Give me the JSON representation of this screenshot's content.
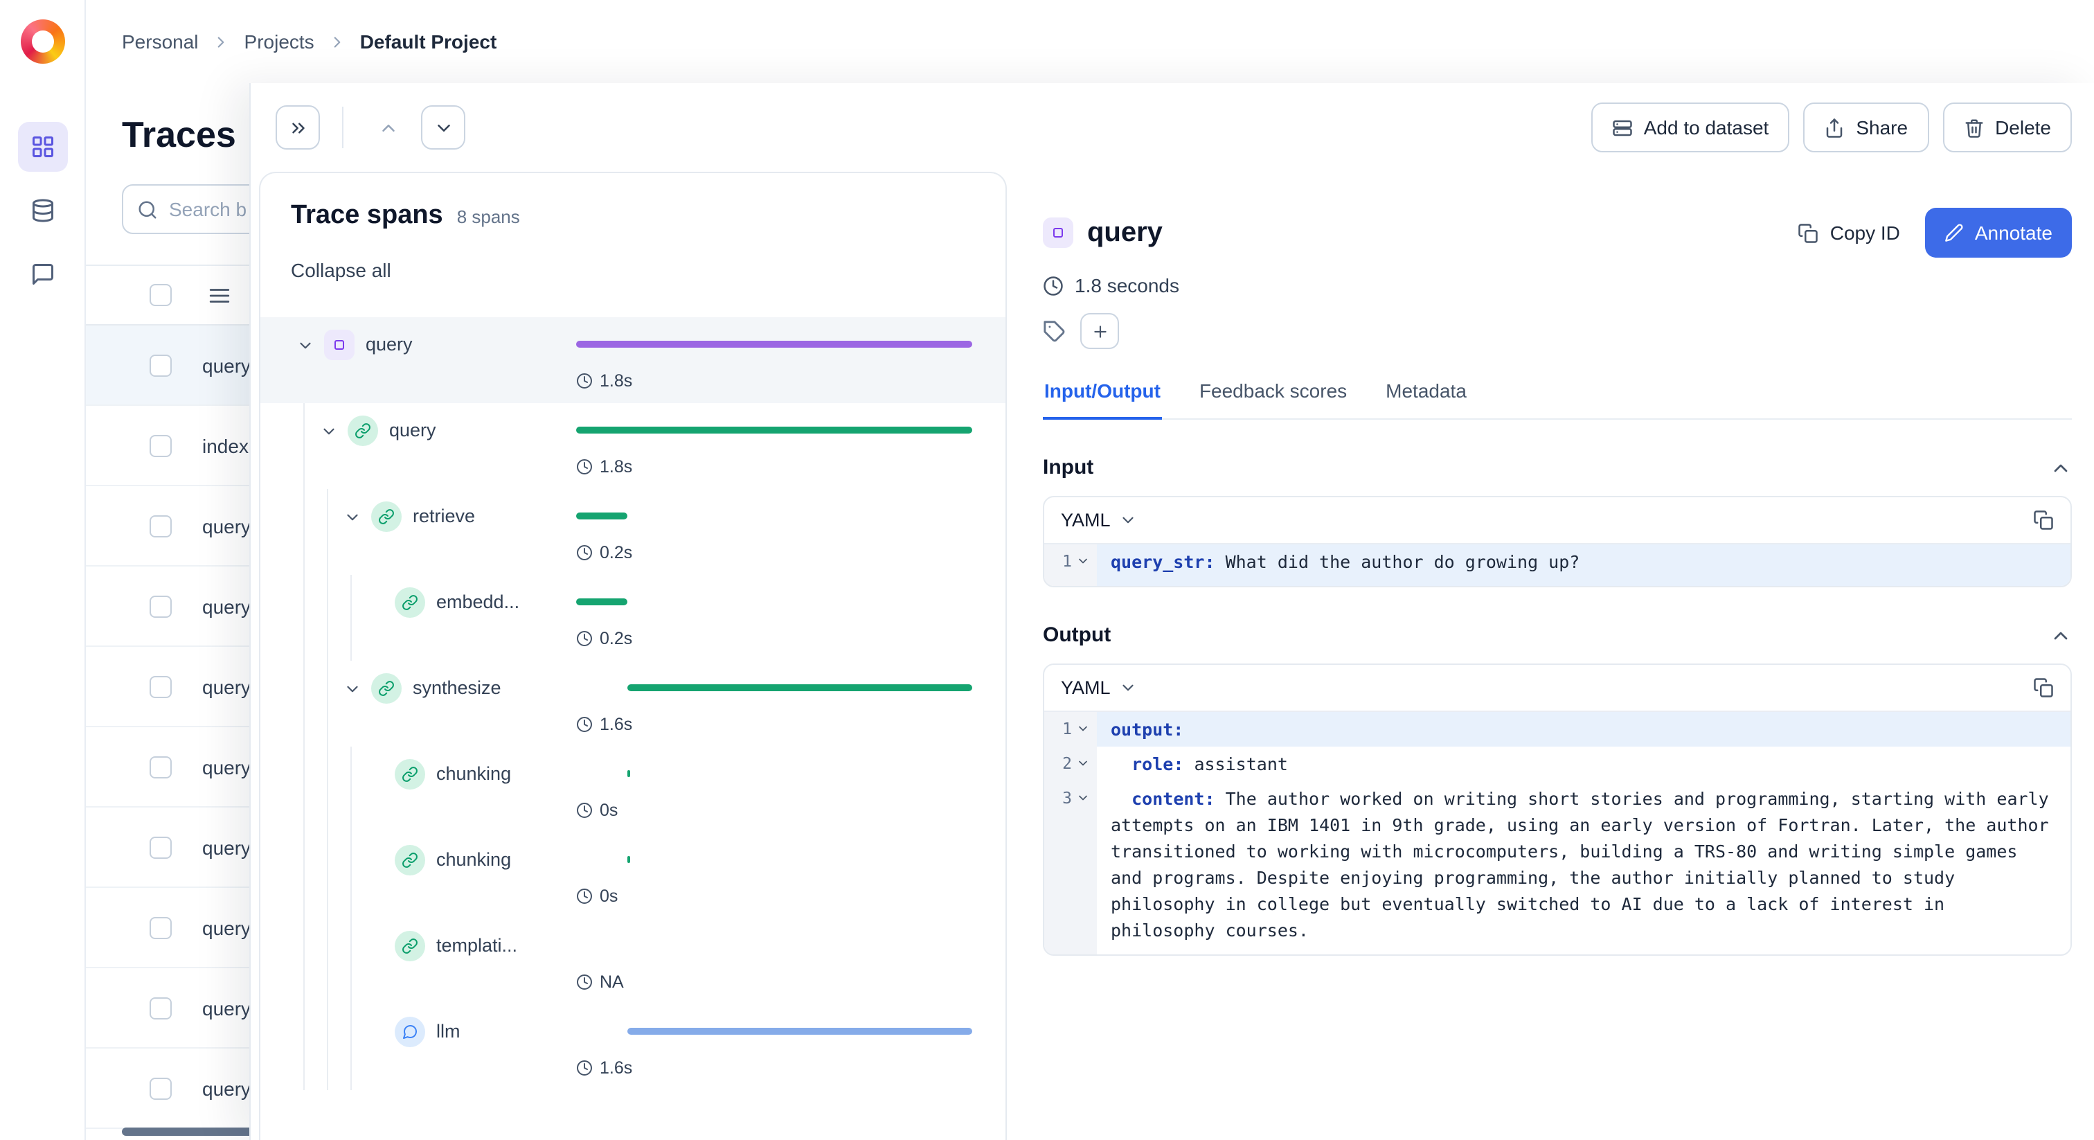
{
  "colors": {
    "accent_purple": "#7c3aed",
    "bar_purple": "#9b66e3",
    "bar_green": "#15a470",
    "bar_blue": "#85abe9",
    "primary_blue": "#3d6be8",
    "tab_active_blue": "#2563eb",
    "yaml_key_blue": "#1e40af"
  },
  "icons": {
    "logo": "comet-logo",
    "sidebar": [
      "grid-icon",
      "database-icon",
      "chat-icon"
    ],
    "toolbar": [
      "double-chevron-right-icon",
      "chevron-up-icon",
      "chevron-down-icon",
      "dataset-icon",
      "share-icon",
      "trash-icon"
    ],
    "details": [
      "copy-icon",
      "pen-icon",
      "clock-icon",
      "tag-icon",
      "plus-icon",
      "search-icon",
      "menu-icon"
    ]
  },
  "breadcrumb": {
    "items": [
      "Personal",
      "Projects",
      "Default Project"
    ]
  },
  "traces_list": {
    "title": "Traces",
    "search_placeholder": "Search b",
    "rows": [
      {
        "label": "query",
        "selected": true
      },
      {
        "label": "index",
        "selected": false
      },
      {
        "label": "query",
        "selected": false
      },
      {
        "label": "query",
        "selected": false
      },
      {
        "label": "query",
        "selected": false
      },
      {
        "label": "query",
        "selected": false
      },
      {
        "label": "query",
        "selected": false
      },
      {
        "label": "query",
        "selected": false
      },
      {
        "label": "query",
        "selected": false
      },
      {
        "label": "query",
        "selected": false
      }
    ]
  },
  "toolbar": {
    "add_to_dataset": "Add to dataset",
    "share": "Share",
    "delete": "Delete"
  },
  "spans_panel": {
    "title": "Trace spans",
    "count_label": "8 spans",
    "collapse_all": "Collapse all",
    "spans": [
      {
        "name": "query",
        "duration": "1.8s",
        "level": 0,
        "type": "trace",
        "expandable": true,
        "selected": true,
        "bar": {
          "start": 0,
          "width": 100,
          "color": "purple"
        }
      },
      {
        "name": "query",
        "duration": "1.8s",
        "level": 1,
        "type": "general",
        "expandable": true,
        "selected": false,
        "bar": {
          "start": 0,
          "width": 100,
          "color": "green"
        }
      },
      {
        "name": "retrieve",
        "duration": "0.2s",
        "level": 2,
        "type": "general",
        "expandable": true,
        "selected": false,
        "bar": {
          "start": 0,
          "width": 13,
          "color": "green"
        }
      },
      {
        "name": "embedd...",
        "duration": "0.2s",
        "level": 3,
        "type": "general",
        "expandable": false,
        "selected": false,
        "bar": {
          "start": 0,
          "width": 13,
          "color": "green"
        }
      },
      {
        "name": "synthesize",
        "duration": "1.6s",
        "level": 2,
        "type": "general",
        "expandable": true,
        "selected": false,
        "bar": {
          "start": 13,
          "width": 87,
          "color": "green"
        }
      },
      {
        "name": "chunking",
        "duration": "0s",
        "level": 3,
        "type": "general",
        "expandable": false,
        "selected": false,
        "bar": {
          "start": 13,
          "width": 0.8,
          "color": "green"
        }
      },
      {
        "name": "chunking",
        "duration": "0s",
        "level": 3,
        "type": "general",
        "expandable": false,
        "selected": false,
        "bar": {
          "start": 13,
          "width": 0.8,
          "color": "green"
        }
      },
      {
        "name": "templati...",
        "duration": "NA",
        "level": 3,
        "type": "general",
        "expandable": false,
        "selected": false,
        "bar": null
      },
      {
        "name": "llm",
        "duration": "1.6s",
        "level": 3,
        "type": "llm",
        "expandable": false,
        "selected": false,
        "bar": {
          "start": 13,
          "width": 87,
          "color": "blue"
        }
      }
    ]
  },
  "details": {
    "title": "query",
    "duration": "1.8 seconds",
    "copy_id_label": "Copy ID",
    "annotate_label": "Annotate",
    "tabs": [
      {
        "label": "Input/Output",
        "active": true
      },
      {
        "label": "Feedback scores",
        "active": false
      },
      {
        "label": "Metadata",
        "active": false
      }
    ],
    "input": {
      "heading": "Input",
      "format": "YAML",
      "lines": [
        {
          "num": "1",
          "highlight": true,
          "fold": false,
          "segments": [
            {
              "t": "query_str:",
              "k": true
            },
            {
              "t": " What did the author do growing up?"
            }
          ]
        }
      ]
    },
    "output": {
      "heading": "Output",
      "format": "YAML",
      "lines": [
        {
          "num": "1",
          "highlight": true,
          "fold": true,
          "segments": [
            {
              "t": "output:",
              "k": true
            }
          ]
        },
        {
          "num": "2",
          "highlight": false,
          "fold": false,
          "segments": [
            {
              "t": "  "
            },
            {
              "t": "role:",
              "k": true
            },
            {
              "t": " assistant"
            }
          ]
        },
        {
          "num": "3",
          "highlight": false,
          "fold": false,
          "segments": [
            {
              "t": "  "
            },
            {
              "t": "content:",
              "k": true
            },
            {
              "t": " The author worked on writing short stories and programming, starting with early attempts on an IBM 1401 in 9th grade, using an early version of Fortran. Later, the author transitioned to working with microcomputers, building a TRS-80 and writing simple games and programs. Despite enjoying programming, the author initially planned to study philosophy in college but eventually switched to AI due to a lack of interest in philosophy courses."
            }
          ]
        }
      ]
    }
  }
}
